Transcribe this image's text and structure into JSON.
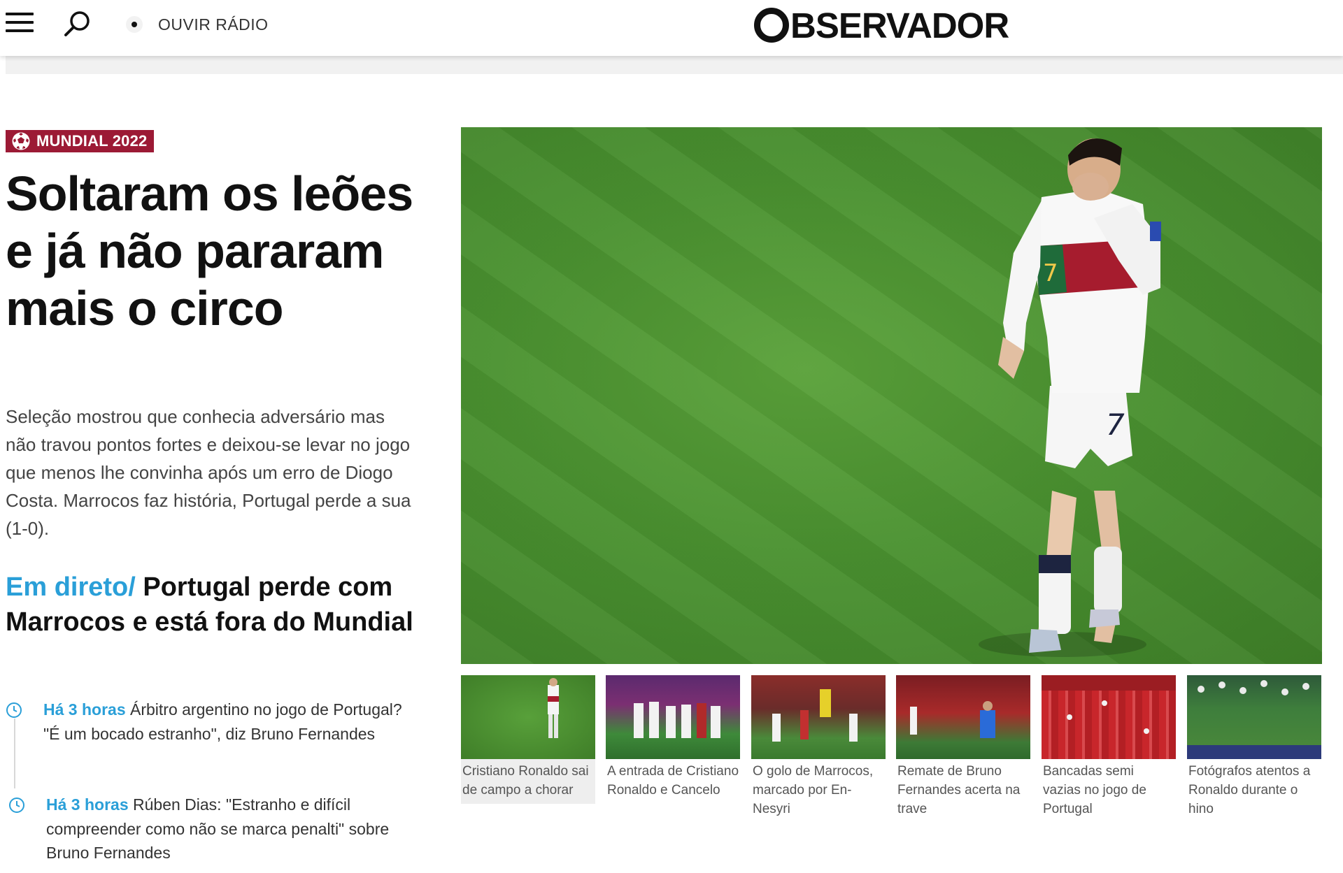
{
  "header": {
    "menu_icon": "hamburger-menu-icon",
    "search_icon": "search-icon",
    "radio_label": "OUVIR RÁDIO",
    "logo_text": "BSERVADOR"
  },
  "article": {
    "tag": "MUNDIAL 2022",
    "tag_color": "#9c1a35",
    "headline": "Soltaram os leões e já não pararam mais o circo",
    "lead": "Seleção mostrou que conhecia adversário mas não travou pontos fortes e deixou-se levar no jogo que menos lhe convinha após um erro de Diogo Costa. Marrocos faz história, Portugal perde a sua (1-0).",
    "live_prefix": "Em direto/",
    "live_title": " Portugal perde com Marrocos e está fora do Mundial",
    "accent_color": "#2a9fd8"
  },
  "feed": [
    {
      "time": "Há 3 horas",
      "text": " Árbitro argentino no jogo de Portugal? \"É um bocado estranho\", diz Bruno Fernandes"
    },
    {
      "time": "Há 3 horas",
      "text": " Rúben Dias: \"Estranho e difícil compreender como não se marca penalti\" sobre Bruno Fernandes"
    }
  ],
  "gallery": [
    {
      "caption": "Cristiano Ronaldo sai de campo a chorar"
    },
    {
      "caption": "A entrada de Cristiano Ronaldo e Cancelo"
    },
    {
      "caption": "O golo de Marrocos, marcado por En-Nesyri"
    },
    {
      "caption": "Remate de Bruno Fernandes acerta na trave"
    },
    {
      "caption": "Bancadas semi vazias no jogo de Portugal"
    },
    {
      "caption": "Fotógrafos atentos a Ronaldo durante o hino"
    }
  ]
}
